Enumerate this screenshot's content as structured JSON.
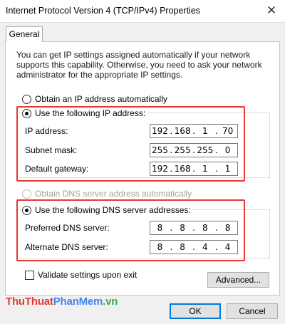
{
  "window": {
    "title": "Internet Protocol Version 4 (TCP/IPv4) Properties",
    "close_glyph": "✕"
  },
  "tabs": [
    {
      "label": "General",
      "selected": true
    }
  ],
  "description": "You can get IP settings assigned automatically if your network supports this capability. Otherwise, you need to ask your network administrator for the appropriate IP settings.",
  "ip_mode": {
    "auto_label": "Obtain an IP address automatically",
    "manual_label": "Use the following IP address:",
    "selected": "manual"
  },
  "ip_fields": [
    {
      "label": "IP address:",
      "octets": [
        "192",
        "168",
        "1",
        "70"
      ]
    },
    {
      "label": "Subnet mask:",
      "octets": [
        "255",
        "255",
        "255",
        "0"
      ]
    },
    {
      "label": "Default gateway:",
      "octets": [
        "192",
        "168",
        "1",
        "1"
      ]
    }
  ],
  "dns_mode": {
    "auto_label": "Obtain DNS server address automatically",
    "manual_label": "Use the following DNS server addresses:",
    "selected": "manual"
  },
  "dns_fields": [
    {
      "label": "Preferred DNS server:",
      "octets": [
        "8",
        "8",
        "8",
        "8"
      ]
    },
    {
      "label": "Alternate DNS server:",
      "octets": [
        "8",
        "8",
        "4",
        "4"
      ]
    }
  ],
  "validate": {
    "label": "Validate settings upon exit",
    "checked": false
  },
  "buttons": {
    "advanced": "Advanced...",
    "ok": "OK",
    "cancel": "Cancel"
  },
  "watermark": {
    "part1": "Thu",
    "part2": "Thuat",
    "part3": "PhanMem",
    "part4": ".vn"
  },
  "colors": {
    "highlight_frame": "#e53935",
    "default_button_border": "#0078d7",
    "dialog_background": "#f0f0f0"
  }
}
